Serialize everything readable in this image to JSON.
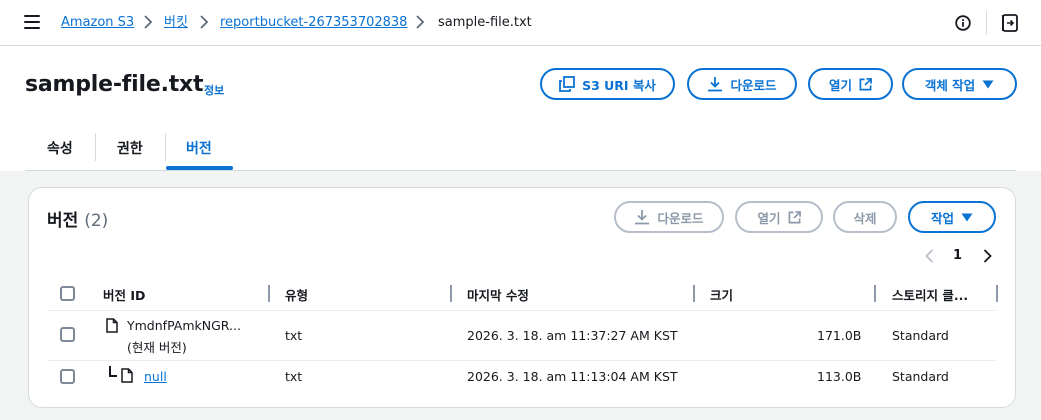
{
  "breadcrumb": {
    "items": [
      "Amazon S3",
      "버킷",
      "reportbucket-267353702838",
      "sample-file.txt"
    ]
  },
  "header": {
    "title": "sample-file.txt",
    "info_label": "정보",
    "buttons": {
      "copy_uri": "S3 URI 복사",
      "download": "다운로드",
      "open": "열기",
      "object_actions": "객체 작업"
    }
  },
  "tabs": [
    "속성",
    "권한",
    "버전"
  ],
  "active_tab": "버전",
  "versions": {
    "title": "버전",
    "count": "(2)",
    "buttons": {
      "download": "다운로드",
      "open": "열기",
      "delete": "삭제",
      "actions": "작업"
    },
    "pagination": {
      "current_page": "1"
    },
    "columns": [
      "버전 ID",
      "유형",
      "마지막 수정",
      "크기",
      "스토리지 클..."
    ],
    "rows": [
      {
        "version_id": "YmdnfPAmkNGR...",
        "note": "(현재 버전)",
        "type": "txt",
        "last_modified": "2026. 3. 18. am 11:37:27 AM KST",
        "size": "171.0B",
        "storage_class": "Standard"
      },
      {
        "version_id": "null",
        "type": "txt",
        "last_modified": "2026. 3. 18. am 11:13:04 AM KST",
        "size": "113.0B",
        "storage_class": "Standard"
      }
    ]
  },
  "colors": {
    "accent": "#0972d3",
    "text": "#16191f",
    "disabled": "#8d99a8",
    "border": "#d5dbdb"
  },
  "icons": [
    "menu-icon",
    "chevron-right-icon",
    "info-circle-icon",
    "side-panel-icon",
    "copy-icon",
    "download-icon",
    "external-link-icon",
    "caret-down-icon",
    "chevron-left-icon",
    "file-icon",
    "tree-branch-icon"
  ]
}
